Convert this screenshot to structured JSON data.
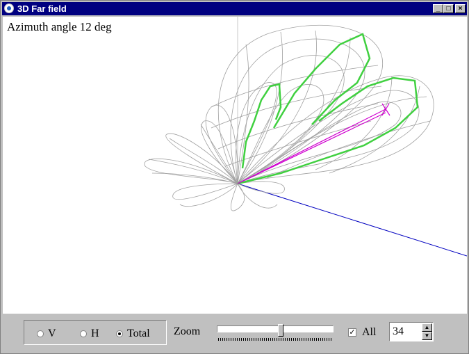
{
  "window": {
    "title": "3D Far field"
  },
  "title_buttons": {
    "minimize": "_",
    "maximize": "□",
    "close": "×"
  },
  "plot": {
    "angle_text": "Azimuth angle 12 deg"
  },
  "controls": {
    "radio_v": "V",
    "radio_h": "H",
    "radio_total": "Total",
    "selected_polarization": "Total",
    "zoom_label": "Zoom",
    "zoom_level": 0.55,
    "all_label": "All",
    "all_checked": true,
    "spin_value": "34"
  },
  "colors": {
    "mesh": "#a0a0a0",
    "cut": "#40d040",
    "axis": "#0000c0",
    "vector": "#d000d0",
    "titlebar": "#000080"
  },
  "icons": [
    "app-icon",
    "minimize-icon",
    "maximize-icon",
    "close-icon",
    "spin-up-icon",
    "spin-down-icon"
  ]
}
